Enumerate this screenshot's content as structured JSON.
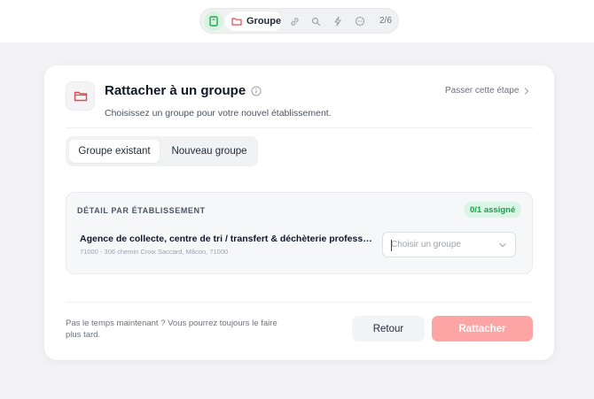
{
  "stepper": {
    "steps": [
      {
        "icon": "document-icon",
        "state": "done"
      },
      {
        "icon": "folder-icon",
        "label": "Groupe",
        "state": "active"
      },
      {
        "icon": "link-icon",
        "state": "pending"
      },
      {
        "icon": "search-icon",
        "state": "pending"
      },
      {
        "icon": "bolt-icon",
        "state": "pending"
      },
      {
        "icon": "chat-icon",
        "state": "pending"
      }
    ],
    "progress": "2/6"
  },
  "card": {
    "title": "Rattacher à un groupe",
    "subtitle": "Choisissez un groupe pour votre nouvel établissement.",
    "skip_label": "Passer cette étape",
    "tabs": [
      {
        "label": "Groupe existant",
        "active": true
      },
      {
        "label": "Nouveau groupe",
        "active": false
      }
    ],
    "detail": {
      "heading": "DÉTAIL PAR ÉTABLISSEMENT",
      "badge": "0/1 assigné",
      "establishment": {
        "name": "Agence de collecte, centre de tri / transfert & déchèterie profession...",
        "address": "71000 - 306 chemin Croix Saccard, Mâcon, 71000",
        "select_placeholder": "Choisir un groupe"
      }
    },
    "footer": {
      "note": "Pas le temps maintenant ? Vous pourrez toujours le faire plus tard.",
      "back_label": "Retour",
      "attach_label": "Rattacher"
    }
  },
  "colors": {
    "accent": "#e5484d",
    "attach_button": "#fda4a4",
    "success": "#16a34a",
    "success_bg": "#d9f5e3"
  }
}
